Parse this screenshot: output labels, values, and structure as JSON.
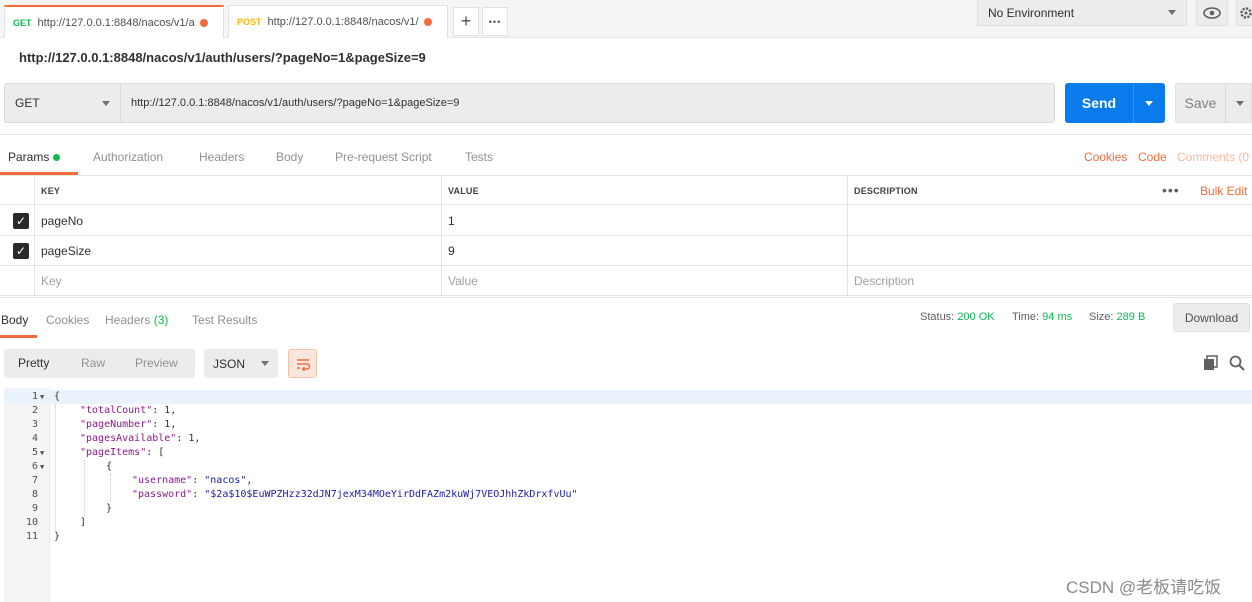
{
  "tabs": [
    {
      "method": "GET",
      "url": "http://127.0.0.1:8848/nacos/v1/a"
    },
    {
      "method": "POST",
      "url": "http://127.0.0.1:8848/nacos/v1/"
    }
  ],
  "tab_actions": {
    "new_tab": "+",
    "more": "•••"
  },
  "environment": {
    "selected": "No Environment"
  },
  "request": {
    "title": "http://127.0.0.1:8848/nacos/v1/auth/users/?pageNo=1&pageSize=9",
    "method": "GET",
    "url": "http://127.0.0.1:8848/nacos/v1/auth/users/?pageNo=1&pageSize=9",
    "send_label": "Send",
    "save_label": "Save"
  },
  "request_tabs": [
    "Params",
    "Authorization",
    "Headers",
    "Body",
    "Pre-request Script",
    "Tests"
  ],
  "request_links": {
    "cookies": "Cookies",
    "code": "Code",
    "comments": "Comments (0"
  },
  "params": {
    "headers": {
      "key": "KEY",
      "value": "VALUE",
      "description": "DESCRIPTION"
    },
    "bulk_edit": "Bulk Edit",
    "rows": [
      {
        "checked": true,
        "key": "pageNo",
        "value": "1",
        "description": ""
      },
      {
        "checked": true,
        "key": "pageSize",
        "value": "9",
        "description": ""
      }
    ],
    "placeholder": {
      "key": "Key",
      "value": "Value",
      "description": "Description"
    }
  },
  "response": {
    "tabs": {
      "body": "Body",
      "cookies": "Cookies",
      "headers": "Headers",
      "headers_count": "(3)",
      "test_results": "Test Results"
    },
    "status_label": "Status:",
    "status_value": "200 OK",
    "time_label": "Time:",
    "time_value": "94 ms",
    "size_label": "Size:",
    "size_value": "289 B",
    "download_label": "Download",
    "formats": [
      "Pretty",
      "Raw",
      "Preview"
    ],
    "language": "JSON",
    "body_lines": [
      {
        "n": "1",
        "fold": true,
        "indent": 0,
        "text": "{"
      },
      {
        "n": "2",
        "fold": false,
        "indent": 1,
        "key": "\"totalCount\"",
        "sep": ": ",
        "val": "1",
        "tail": ","
      },
      {
        "n": "3",
        "fold": false,
        "indent": 1,
        "key": "\"pageNumber\"",
        "sep": ": ",
        "val": "1",
        "tail": ","
      },
      {
        "n": "4",
        "fold": false,
        "indent": 1,
        "key": "\"pagesAvailable\"",
        "sep": ": ",
        "val": "1",
        "tail": ","
      },
      {
        "n": "5",
        "fold": true,
        "indent": 1,
        "key": "\"pageItems\"",
        "sep": ": ",
        "val": "",
        "tail": "["
      },
      {
        "n": "6",
        "fold": true,
        "indent": 2,
        "text": "{"
      },
      {
        "n": "7",
        "fold": false,
        "indent": 3,
        "key": "\"username\"",
        "sep": ": ",
        "sval": "\"nacos\"",
        "tail": ","
      },
      {
        "n": "8",
        "fold": false,
        "indent": 3,
        "key": "\"password\"",
        "sep": ": ",
        "sval": "\"$2a$10$EuWPZHzz32dJN7jexM34MOeYirDdFAZm2kuWj7VEOJhhZkDrxfvUu\"",
        "tail": ""
      },
      {
        "n": "9",
        "fold": false,
        "indent": 2,
        "text": "}"
      },
      {
        "n": "10",
        "fold": false,
        "indent": 1,
        "text": "]"
      },
      {
        "n": "11",
        "fold": false,
        "indent": 0,
        "text": "}"
      }
    ]
  },
  "watermark": "CSDN @老板请吃饭",
  "colors": {
    "accent": "#f26b3a",
    "send": "#097bed",
    "success": "#0cbb52"
  }
}
